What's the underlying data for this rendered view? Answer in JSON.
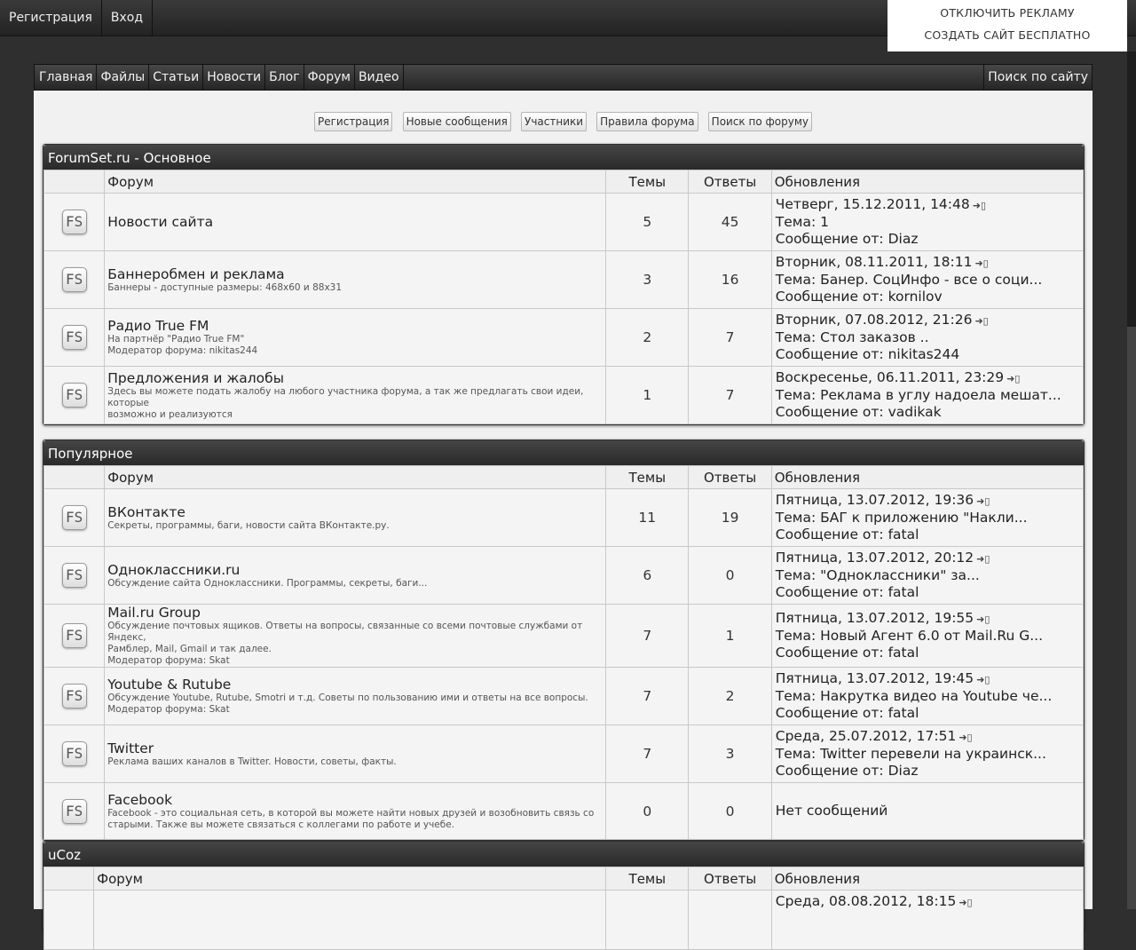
{
  "topbar": {
    "register": "Регистрация",
    "login": "Вход"
  },
  "ad": {
    "disable": "ОТКЛЮЧИТЬ РЕКЛАМУ",
    "create": "СОЗДАТЬ САЙТ БЕСПЛАТНО"
  },
  "nav": {
    "items": [
      "Главная",
      "Файлы",
      "Статьи",
      "Новости",
      "Блог",
      "Форум",
      "Видео"
    ],
    "search": "Поиск по сайту"
  },
  "buttons": [
    "Регистрация",
    "Новые сообщения",
    "Участники",
    "Правила форума",
    "Поиск по форуму"
  ],
  "columns": {
    "forum": "Форум",
    "topics": "Темы",
    "replies": "Ответы",
    "updates": "Обновления"
  },
  "icon_text": "FS",
  "sections": [
    {
      "title": "ForumSet.ru - Основное",
      "rows": [
        {
          "name": "Новости сайта",
          "desc": [],
          "topics": "5",
          "replies": "45",
          "upd": [
            "Четверг, 15.12.2011, 14:48",
            "Тема: 1",
            "Сообщение от: Diaz"
          ]
        },
        {
          "name": "Баннеробмен и реклама",
          "desc": [
            "Баннеры - доступные размеры: 468x60 и 88x31"
          ],
          "topics": "3",
          "replies": "16",
          "upd": [
            "Вторник, 08.11.2011, 18:11",
            "Тема: Банер. СоцИнфо - все о соци...",
            "Сообщение от: kornilov"
          ]
        },
        {
          "name": "Радио True FM",
          "desc": [
            "На партнёр \"Радио True FM\"",
            "Модератор форума: nikitas244"
          ],
          "topics": "2",
          "replies": "7",
          "upd": [
            "Вторник, 07.08.2012, 21:26",
            "Тема: Стол заказов ..",
            "Сообщение от: nikitas244"
          ]
        },
        {
          "name": "Предложения и жалобы",
          "desc": [
            "Здесь вы можете подать жалобу на любого участника форума, а так же предлагать свои идеи, которые",
            "возможно и реализуются"
          ],
          "topics": "1",
          "replies": "7",
          "upd": [
            "Воскресенье, 06.11.2011, 23:29",
            "Тема: Реклама в углу надоела мешат...",
            "Сообщение от: vadikak"
          ]
        }
      ]
    },
    {
      "title": "Популярное",
      "rows": [
        {
          "name": "ВКонтакте",
          "desc": [
            "Секреты, программы, баги, новости сайта ВКонтакте.ру."
          ],
          "topics": "11",
          "replies": "19",
          "upd": [
            "Пятница, 13.07.2012, 19:36",
            "Тема: БАГ к приложению \"Накли...",
            "Сообщение от: fatal"
          ]
        },
        {
          "name": "Одноклассники.ru",
          "desc": [
            "Обсуждение сайта Одноклассники. Программы, секреты, баги..."
          ],
          "topics": "6",
          "replies": "0",
          "upd": [
            "Пятница, 13.07.2012, 20:12",
            "Тема: \"Одноклассники\" за...",
            "Сообщение от: fatal"
          ]
        },
        {
          "name": "Mail.ru Group",
          "desc": [
            "Обсуждение почтовых ящиков. Ответы на вопросы, связанные со всеми почтовые службами от Яндекс,",
            "Рамблер, Mail, Gmail и так далее.",
            "Модератор форума: Skat"
          ],
          "topics": "7",
          "replies": "1",
          "upd": [
            "Пятница, 13.07.2012, 19:55",
            "Тема: Новый Агент 6.0 от Mail.Ru G...",
            "Сообщение от: fatal"
          ]
        },
        {
          "name": "Youtube & Rutube",
          "desc": [
            "Обсуждение Youtube, Rutube, Smotri и т.д. Советы по пользованию ими и ответы на все вопросы.",
            "Модератор форума: Skat"
          ],
          "topics": "7",
          "replies": "2",
          "upd": [
            "Пятница, 13.07.2012, 19:45",
            "Тема: Накрутка видео на Youtube че...",
            "Сообщение от: fatal"
          ]
        },
        {
          "name": "Twitter",
          "desc": [
            "Реклама ваших каналов в Twitter. Новости, советы, факты."
          ],
          "topics": "7",
          "replies": "3",
          "upd": [
            "Среда, 25.07.2012, 17:51",
            "Тема: Twitter перевели на украинск...",
            "Сообщение от: Diaz"
          ]
        },
        {
          "name": "Facebook",
          "desc": [
            "Facebook - это социальная сеть, в которой вы можете найти новых друзей и возобновить связь со",
            "старыми. Также вы можете связаться с коллегами по работе и учебе."
          ],
          "topics": "0",
          "replies": "0",
          "upd": [
            "Нет сообщений"
          ]
        }
      ]
    },
    {
      "title": "uCoz",
      "rows": [
        {
          "name": "",
          "desc": [],
          "topics": "",
          "replies": "",
          "upd": [
            "Среда, 08.08.2012, 18:15"
          ]
        }
      ]
    }
  ]
}
